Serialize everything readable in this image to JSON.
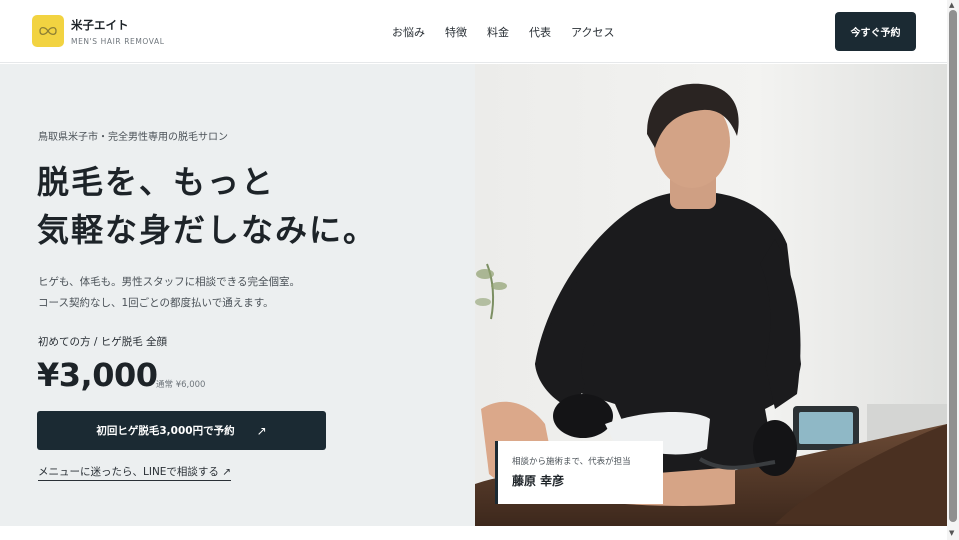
{
  "header": {
    "brand_name": "米子エイト",
    "brand_sub": "MEN'S HAIR REMOVAL",
    "nav": [
      "お悩み",
      "特徴",
      "料金",
      "代表",
      "アクセス"
    ],
    "cta": "今すぐ予約"
  },
  "hero": {
    "eyebrow": "鳥取県米子市・完全男性専用の脱毛サロン",
    "headline_line1": "脱毛を、もっと",
    "headline_line2": "気軽な身だしなみに。",
    "desc_line1": "ヒゲも、体毛も。男性スタッフに相談できる完全個室。",
    "desc_line2": "コース契約なし、1回ごとの都度払いで通えます。",
    "first_label": "初めての方 / ヒゲ脱毛 全顔",
    "price": "¥3,000",
    "price_regular": "通常 ¥6,000",
    "cta_label": "初回ヒゲ脱毛3,000円で予約",
    "cta_arrow": "↗",
    "line_link": "メニューに迷ったら、LINEで相談する ↗"
  },
  "caption": {
    "small": "相談から施術まで、代表が担当",
    "name": "藤原 幸彦"
  },
  "colors": {
    "accent": "#1b2a33",
    "logo_bg": "#f2d341",
    "hero_bg": "#eceff0"
  },
  "icons": {
    "logo": "infinity-icon",
    "scroll_up": "triangle-up-icon",
    "scroll_down": "triangle-down-icon"
  }
}
